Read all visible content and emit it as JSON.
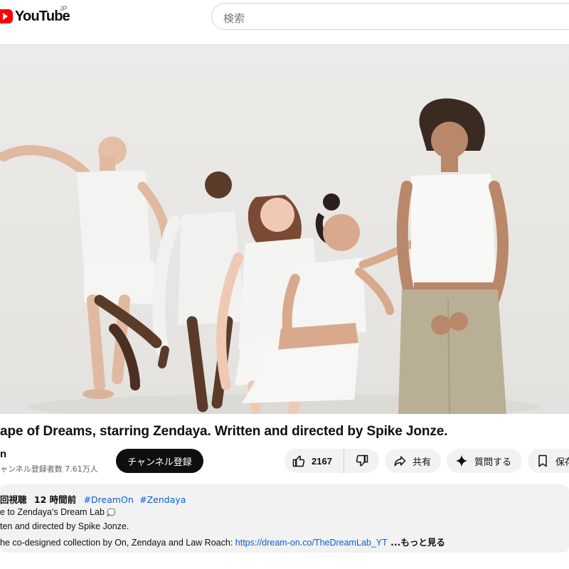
{
  "header": {
    "logo_text": "YouTube",
    "region": "JP",
    "search_placeholder": "検索"
  },
  "video": {
    "title": "ape of Dreams, starring Zendaya. Written and directed by Spike Jonze."
  },
  "channel": {
    "name": "n",
    "subscribers": "ャンネル登録者数 7.61万人",
    "subscribe_label": "チャンネル登録"
  },
  "actions": {
    "like_count": "2167",
    "share_label": "共有",
    "ask_label": "質問する",
    "save_label": "保存"
  },
  "description": {
    "views": "回視聴",
    "age": "12 時間前",
    "tags": [
      "#DreamOn",
      "#Zendaya"
    ],
    "line1": "e to Zendaya's Dream Lab ",
    "line1_emoji": "💭",
    "line2": "ten and directed by Spike Jonze.",
    "line3_text": "he co-designed collection by On, Zendaya and Law Roach: ",
    "line3_link": "https://dream-on.co/TheDreamLab_YT",
    "more_label": " ...もっと見る"
  },
  "colors": {
    "brand_red": "#ff0000",
    "link_blue": "#065fd4",
    "chip_bg": "#f2f2f2",
    "subscribe_bg": "#0f0f0f"
  },
  "icons": [
    "youtube-logo-icon",
    "thumb-up-icon",
    "thumb-down-icon",
    "share-icon",
    "sparkle-icon",
    "save-icon"
  ]
}
